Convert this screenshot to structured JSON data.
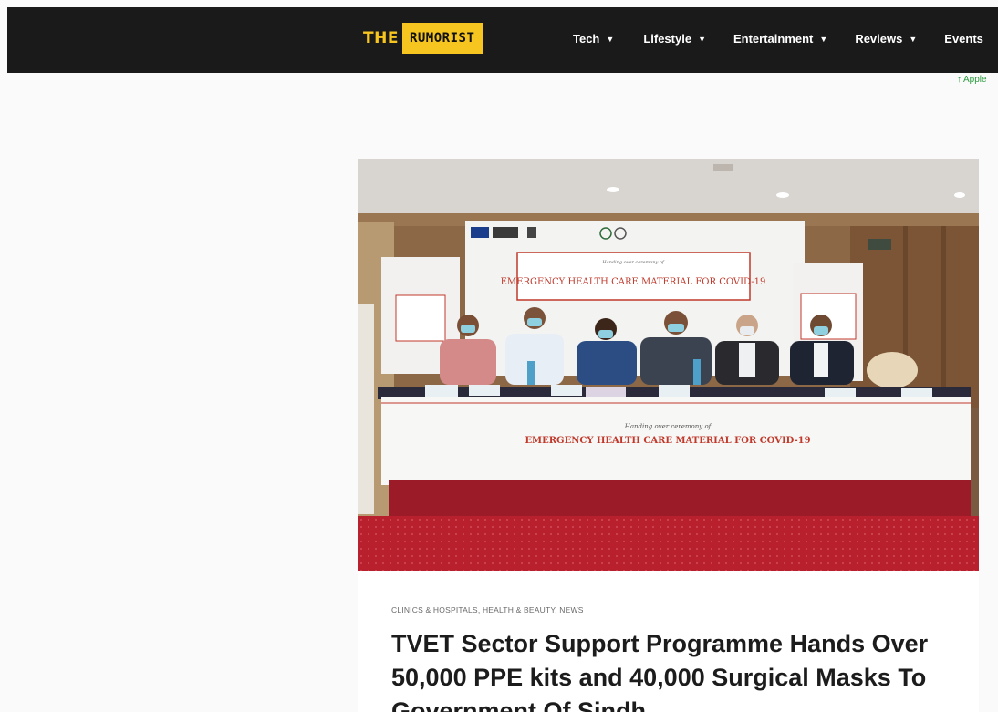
{
  "header": {
    "logo": {
      "the": "THE",
      "name": "RUMORIST"
    },
    "nav": [
      {
        "label": "Tech",
        "icon": "chevron-down-icon"
      },
      {
        "label": "Lifestyle",
        "icon": "chevron-down-icon"
      },
      {
        "label": "Entertainment",
        "icon": "chevron-down-icon"
      },
      {
        "label": "Reviews",
        "icon": "chevron-down-icon"
      },
      {
        "label": "Events"
      }
    ]
  },
  "ticker": {
    "icon": "trending-up-icon",
    "text": "Apple"
  },
  "article": {
    "hero_image": {
      "banner_heading": "EMERGENCY HEALTH CARE MATERIAL FOR COVID-19",
      "banner_small": "Handing over ceremony of",
      "table_heading": "EMERGENCY HEALTH CARE MATERIAL FOR COVID-19",
      "table_small": "Handing over ceremony of"
    },
    "categories": [
      "CLINICS & HOSPITALS",
      "HEALTH & BEAUTY",
      "NEWS"
    ],
    "category_separator": ", ",
    "title": "TVET Sector Support Programme Hands Over 50,000 PPE kits and 40,000 Surgical Masks To Government Of Sindh"
  },
  "colors": {
    "header_bg": "#1a1a1a",
    "logo_accent": "#f7c520",
    "ticker_green": "#2c9a3f",
    "carpet_red": "#b8202e"
  }
}
